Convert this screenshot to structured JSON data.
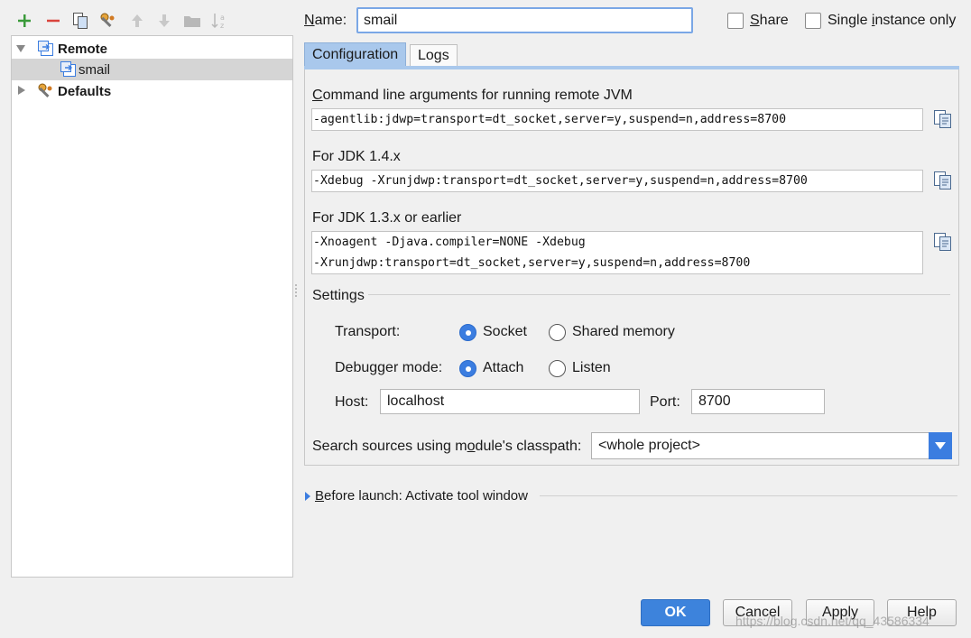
{
  "toolbar": {
    "icons": [
      "add-icon",
      "remove-icon",
      "copy-icon",
      "wrench-icon",
      "move-up-icon",
      "move-down-icon",
      "folder-icon",
      "sort-icon"
    ],
    "colors": {
      "add": "#3a9a3a",
      "remove": "#d9443c"
    }
  },
  "tree": {
    "items": [
      {
        "label": "Remote",
        "expanded": true,
        "bold": true
      },
      {
        "label": "smail",
        "selected": true
      },
      {
        "label": "Defaults",
        "expanded": false,
        "bold": true
      }
    ]
  },
  "header": {
    "name_label_u": "N",
    "name_label_rest": "ame:",
    "name_value": "smail",
    "share_label_u": "S",
    "share_label_rest": "hare",
    "single_label_pre": "Single ",
    "single_label_u": "i",
    "single_label_rest": "nstance only"
  },
  "tabs": [
    {
      "label": "Configuration",
      "active": true
    },
    {
      "label": "Logs",
      "active": false
    }
  ],
  "config": {
    "cmd_label_u": "C",
    "cmd_label_rest": "ommand line arguments for running remote JVM",
    "cmd_value": "-agentlib:jdwp=transport=dt_socket,server=y,suspend=n,address=8700",
    "jdk14_label": "For JDK 1.4.x",
    "jdk14_value": "-Xdebug -Xrunjdwp:transport=dt_socket,server=y,suspend=n,address=8700",
    "jdk13_label": "For JDK 1.3.x or earlier",
    "jdk13_line1": "-Xnoagent -Djava.compiler=NONE -Xdebug",
    "jdk13_line2": "-Xrunjdwp:transport=dt_socket,server=y,suspend=n,address=8700"
  },
  "settings": {
    "title": "Settings",
    "transport_label": "Transport:",
    "transport_options": [
      "Socket",
      "Shared memory"
    ],
    "transport_selected": "Socket",
    "debugger_label": "Debugger mode:",
    "debugger_options": [
      "Attach",
      "Listen"
    ],
    "debugger_selected": "Attach",
    "host_label": "Host:",
    "host_value": "localhost",
    "port_label": "Port:",
    "port_value": "8700",
    "search_label_pre": "Search sources using m",
    "search_label_u": "o",
    "search_label_rest": "dule's classpath:",
    "search_value": "<whole project>"
  },
  "before_launch": {
    "label_u": "B",
    "label_rest": "efore launch: Activate tool window"
  },
  "buttons": {
    "ok": "OK",
    "cancel": "Cancel",
    "apply": "Apply",
    "help": "Help"
  },
  "watermark": "https://blog.csdn.net/qq_43586334",
  "colors": {
    "accent": "#3b7de0",
    "selected_row": "#d5d5d5"
  }
}
